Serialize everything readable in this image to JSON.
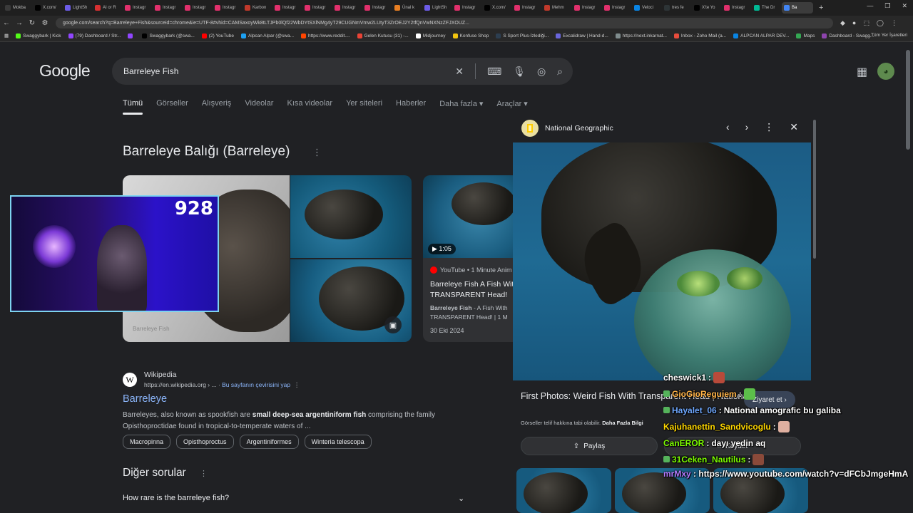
{
  "browser": {
    "tabs": [
      {
        "label": "Mokba",
        "color": "#3a3a3a"
      },
      {
        "label": "X.com/",
        "color": "#000000"
      },
      {
        "label": "LightSh",
        "color": "#6c5ce7"
      },
      {
        "label": "AI or R",
        "color": "#d63031"
      },
      {
        "label": "Instagr",
        "color": "#e1306c"
      },
      {
        "label": "Instagr",
        "color": "#e1306c"
      },
      {
        "label": "Instagr",
        "color": "#e1306c"
      },
      {
        "label": "Instagr",
        "color": "#e1306c"
      },
      {
        "label": "Karbon",
        "color": "#c0392b"
      },
      {
        "label": "Instagr",
        "color": "#e1306c"
      },
      {
        "label": "Instagr",
        "color": "#e1306c"
      },
      {
        "label": "Instagr",
        "color": "#e1306c"
      },
      {
        "label": "Instagr",
        "color": "#e1306c"
      },
      {
        "label": "Ünal k",
        "color": "#e67e22"
      },
      {
        "label": "LightSh",
        "color": "#6c5ce7"
      },
      {
        "label": "Instagr",
        "color": "#e1306c"
      },
      {
        "label": "X.com/",
        "color": "#000000"
      },
      {
        "label": "Instagr",
        "color": "#e1306c"
      },
      {
        "label": "Mehm",
        "color": "#c0392b"
      },
      {
        "label": "Instagr",
        "color": "#e1306c"
      },
      {
        "label": "Instagr",
        "color": "#e1306c"
      },
      {
        "label": "Veloci",
        "color": "#0984e3"
      },
      {
        "label": "tres fe",
        "color": "#2d3436"
      },
      {
        "label": "X'te Yo",
        "color": "#000000"
      },
      {
        "label": "Instagr",
        "color": "#e1306c"
      },
      {
        "label": "The Dr",
        "color": "#00b894"
      },
      {
        "label": "Ba",
        "color": "#4285f4",
        "active": true
      }
    ],
    "url": "google.com/search?q=Barreleye+Fish&sourceid=chrome&ie=UTF-8#vhid=CAMSaxoyWk8tLTJPb0lQf22WbDYtSXlNMg4yT29CUGNmVmw2LUtyT3ZrOEJ2Y2tfQnVwNXNzZFJXOUZ...",
    "bookmarks": [
      {
        "label": "Swaggybark | Kick",
        "color": "#53fc18"
      },
      {
        "label": "(79) Dashboard / Str...",
        "color": "#9146ff"
      },
      {
        "label": "",
        "color": "#9146ff"
      },
      {
        "label": "Swaggybark (@swa...",
        "color": "#000000"
      },
      {
        "label": "(2) YouTube",
        "color": "#ff0000"
      },
      {
        "label": "Alpcan Alpar (@swa...",
        "color": "#1da1f2"
      },
      {
        "label": "https://www.reddit....",
        "color": "#ff4500"
      },
      {
        "label": "Gelen Kutusu (31) -...",
        "color": "#ea4335"
      },
      {
        "label": "Midjourney",
        "color": "#ffffff"
      },
      {
        "label": "Konfuse Shop",
        "color": "#f1c40f"
      },
      {
        "label": "S Sport Plus-İzlediği...",
        "color": "#2c3e50"
      },
      {
        "label": "Excalidraw | Hand-d...",
        "color": "#6965db"
      },
      {
        "label": "https://next.inkarnat...",
        "color": "#7f8c8d"
      },
      {
        "label": "Inbox - Zoho Mail (a...",
        "color": "#e74c3c"
      },
      {
        "label": "ALPCAN ALPAR DEV...",
        "color": "#0984e3"
      },
      {
        "label": "Maps",
        "color": "#34a853"
      },
      {
        "label": "Dashboard - Swagg...",
        "color": "#8e44ad"
      }
    ],
    "bookmarks_all": "Tüm Yer İşaretleri"
  },
  "google": {
    "logo": "Google",
    "query": "Barreleye Fish",
    "tabs": [
      "Tümü",
      "Görseller",
      "Alışveriş",
      "Videolar",
      "Kısa videolar",
      "Yer siteleri",
      "Haberler",
      "Daha fazla ▾",
      "Araçlar ▾"
    ]
  },
  "knowledge": {
    "title": "Barreleye Balığı (Barreleye)",
    "image_watermark": "Barreleye Fish"
  },
  "video": {
    "duration": "1:05",
    "source": "YouTube • 1 Minute Anim",
    "title": "Barreleye Fish A Fish With TRANSPARENT Head!",
    "desc_bold": "Barreleye Fish",
    "desc": " - A Fish With TRANSPARENT Head! | 1 M",
    "date": "30 Eki 2024"
  },
  "stream": {
    "counter": "928"
  },
  "wiki": {
    "site": "Wikipedia",
    "url": "https://en.wikipedia.org › ...",
    "translate": "Bu sayfanın çevirisini yap",
    "title": "Barreleye",
    "snippet_a": "Barreleyes, also known as spookfish are ",
    "snippet_b": "small deep-sea argentiniform fish",
    "snippet_c": " comprising the family Opisthoproctidae found in tropical-to-temperate waters of ...",
    "chips": [
      "Macropinna",
      "Opisthoproctus",
      "Argentiniformes",
      "Winteria telescopa"
    ]
  },
  "other": {
    "heading": "Diğer sorular",
    "question": "How rare is the barreleye fish?"
  },
  "viewer": {
    "source": "National Geographic",
    "title": "First Photos: Weird Fish With Transparent Head | National ...",
    "visit": "Ziyaret et",
    "note_a": "Görseller telif hakkına tabi olabilir. ",
    "note_b": "Daha Fazla Bilgi",
    "share": "Paylaş",
    "save": "Kaydet"
  },
  "chat": [
    {
      "user": "cheswick1",
      "color": "#ffffff",
      "text": "",
      "emote": "#b84a3a"
    },
    {
      "user": "GioGioReguiem",
      "color": "#ffb347",
      "text": "",
      "emote": "#5cbf4a",
      "badge": true
    },
    {
      "user": "Hayalet_06",
      "color": "#6fa8ff",
      "text": "National amografic bu galiba",
      "badge": true
    },
    {
      "user": "Kajuhanettin_Sandvicoglu",
      "color": "#ffd700",
      "text": "",
      "emote": "#e0b0a0"
    },
    {
      "user": "CanEROR",
      "color": "#7cfc00",
      "text": "dayı yedin aq"
    },
    {
      "user": "31Ceken_Nautilus",
      "color": "#7cfc00",
      "text": "",
      "emote": "#8a4a3a",
      "badge": true
    },
    {
      "user": "mrMxy",
      "color": "#b57bff",
      "text": "https://www.youtube.com/watch?v=dFCbJmgeHmA"
    }
  ]
}
